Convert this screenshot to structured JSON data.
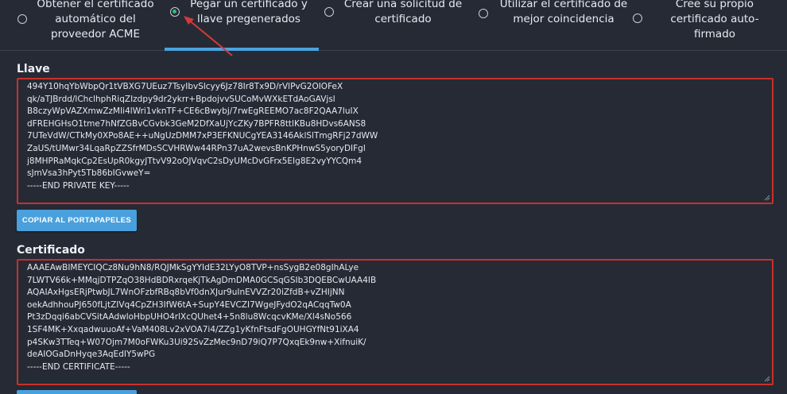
{
  "tabs": [
    {
      "label": "Obtener el certificado\nautomático del\nproveedor ACME",
      "checked": false
    },
    {
      "label": "Pegar un certificado y\nllave pregenerados",
      "checked": true
    },
    {
      "label": "Crear una solicitud de\ncertificado",
      "checked": false
    },
    {
      "label": "Utilizar el certificado de\nmejor coincidencia",
      "checked": false
    },
    {
      "label": "Cree su propio\ncertificado auto-\nfirmado",
      "checked": false
    }
  ],
  "key": {
    "label": "Llave",
    "lines": [
      "494Y10hqYbWbpQr1tVBXG7UEuz7TsyIbvSlcyy6Jz78Ir8Tx9D/rVlPvG2OIOFeX",
      "qk/aTJBrdd/lChclhphRiqZIzdpy9dr2ykrr+BpdojvvSUCoMvWXkETdAoGAVjsl",
      "B8czyWpVAZXmwZzMIi4lWri1vknTF+CE6cBwybj/7rwEgREEMO7ac8F2QAA7luIX",
      "dFREHGHsO1tme7hNfZGBvCGvbk3GeM2DfXaUjYcZKy7BPFR8ttlKBu8HDvs6ANS8",
      "7UTeVdW/CTkMy0XPo8AE++uNgUzDMM7xP3EFKNUCgYEA3146AklSlTmgRFj27dWW",
      "ZaUS/tUMwr34LqaRpZZSfrMDsSCVHRWw44RPn37uA2wevsBnKPHnwS5yoryDIFgl",
      "j8MHPRaMqkCp2EsUpR0kgyJTtvV92oOJVqvC2sDyUMcDvGFrx5EIg8E2vyYYCQm4",
      "sJmVsa3hPyt5Tb86bIGvweY=",
      "-----END PRIVATE KEY-----"
    ]
  },
  "copy_button_label": "COPIAR AL PORTAPAPELES",
  "certificate": {
    "label": "Certificado",
    "lines": [
      "AAAEAwBIMEYCIQCz8Nu9hN8/RQJMkSgYYIdE32LYyO8TVP+nsSygB2e08gIhALye",
      "7LWTV66k+MMqjDTPZqO38HdBDRxrqeKjTkAgDmDMA0GCSqGSIb3DQEBCwUAA4IB",
      "AQAIAxHgsERjPtwbJL7WnOFzbfRBq8bVf0dnXJur9uInEVVZr20iZfdB+vZHIjNN",
      "oekAdhhouPJ650fLjtZIVq4CpZH3IfW6tA+SupY4EVCZI7WgeJFydO2qACqqTw0A",
      "Pt3zDqqi6abCVSitAAdwloHbpUHO4rlXcQUhet4+5n8lu8WcqcvKMe/Xl4sNo566",
      "1SF4MK+XxqadwuuoAf+VaM408Lv2xVOA7i4/ZZg1yKfnFtsdFgOUHGYfNt91iXA4",
      "p4SKw3TTeq+W07Ojm7M0oFWKu3Ui92SvZzMec9nD79iQ7P7QxqEk9nw+XifnuiK/",
      "deAIOGaDnHyqe3AqEdIY5wPG",
      "-----END CERTIFICATE-----"
    ]
  },
  "colors": {
    "background": "#262a35",
    "accent": "#49a0dc",
    "error_border": "#c9302c",
    "radio_checked": "#2ec26d",
    "annotation_arrow": "#d23a3a"
  }
}
